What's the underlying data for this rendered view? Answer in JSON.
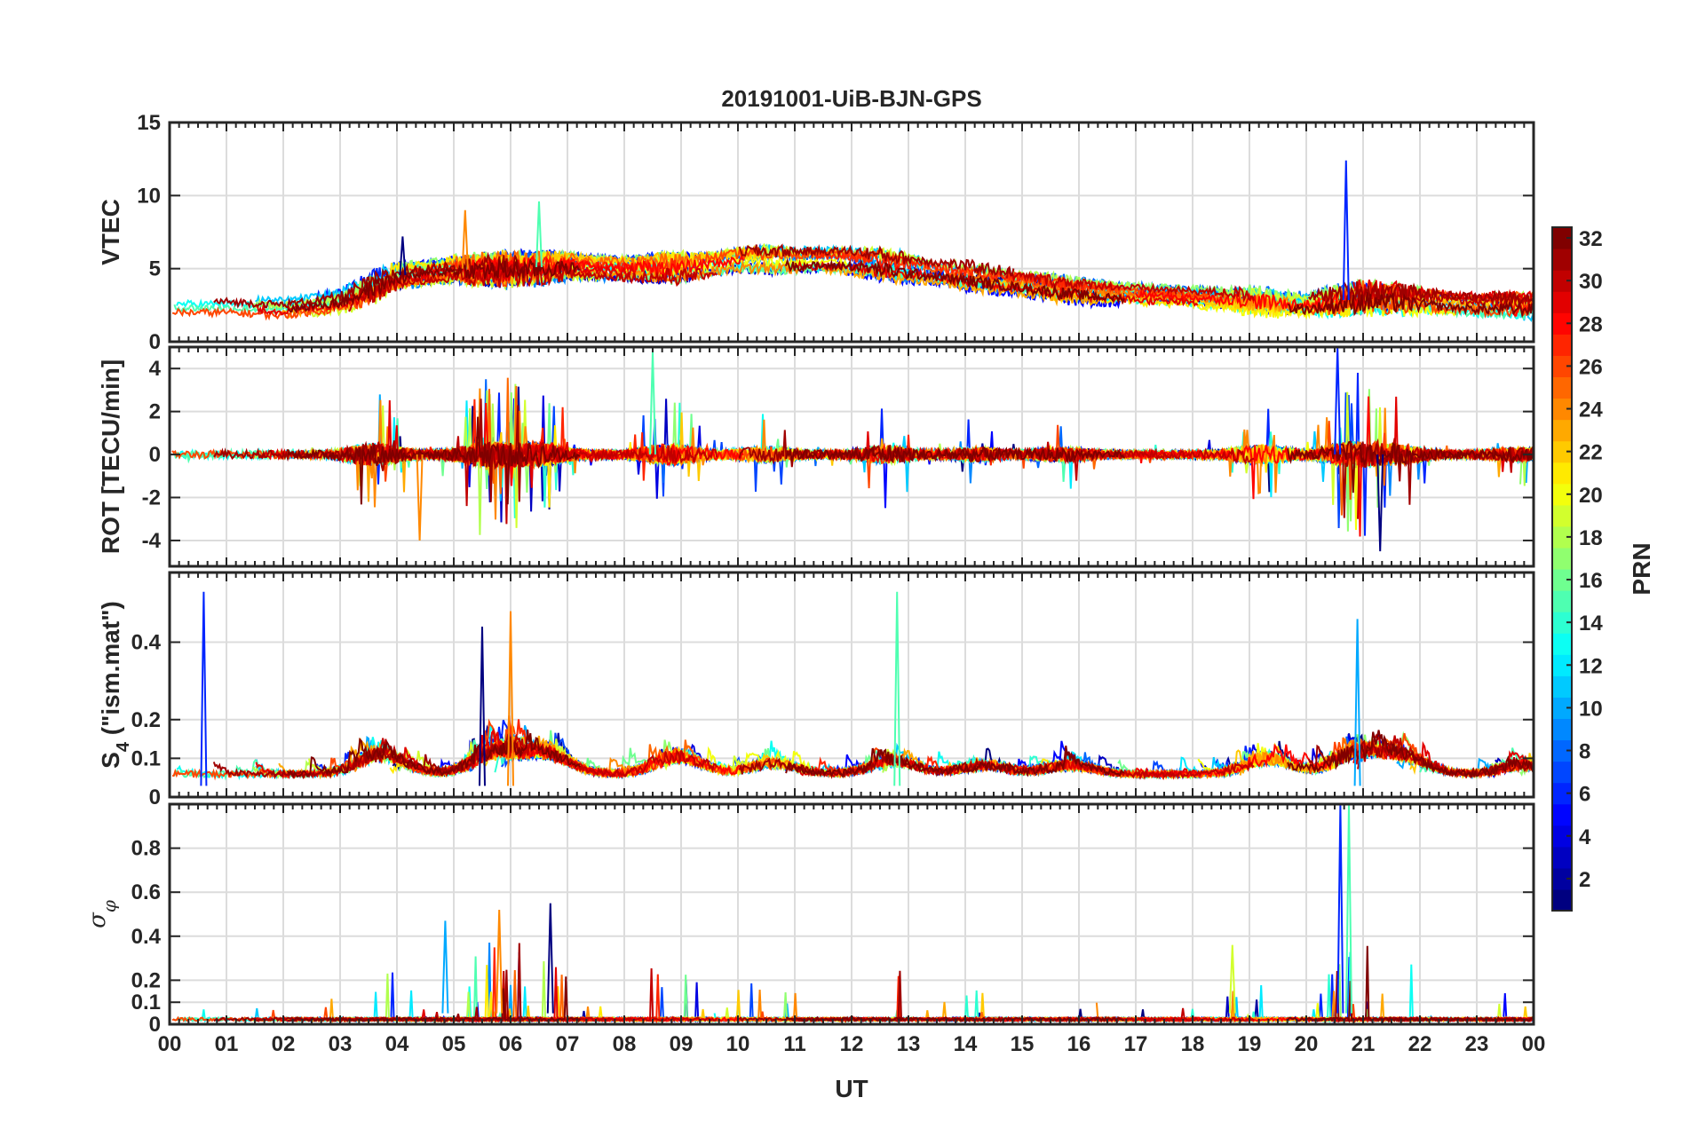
{
  "chart_data": {
    "type": "line",
    "title": "20191001-UiB-BJN-GPS",
    "xlabel": "UT",
    "xlim": [
      0,
      24
    ],
    "x_tick_labels": [
      "00",
      "01",
      "02",
      "03",
      "04",
      "05",
      "06",
      "07",
      "08",
      "09",
      "10",
      "11",
      "12",
      "13",
      "14",
      "15",
      "16",
      "17",
      "18",
      "19",
      "20",
      "21",
      "22",
      "23",
      "00"
    ],
    "grid": true,
    "colorbar": {
      "label": "PRN",
      "range": [
        1,
        32
      ],
      "tick_labels": [
        "2",
        "4",
        "6",
        "8",
        "10",
        "12",
        "14",
        "16",
        "18",
        "20",
        "22",
        "24",
        "26",
        "28",
        "30",
        "32"
      ],
      "colormap": "jet",
      "colors": [
        "#00008f",
        "#0000ff",
        "#0080ff",
        "#00ffff",
        "#80ff80",
        "#ffff00",
        "#ff8000",
        "#ff0000",
        "#800000"
      ]
    },
    "panels": [
      {
        "id": "vtec",
        "ylabel": "VTEC",
        "ylim": [
          0,
          15
        ],
        "y_tick_labels": [
          "0",
          "5",
          "10",
          "15"
        ],
        "description_points": {
          "x": [
            0,
            1,
            2,
            3,
            4,
            5,
            6,
            7,
            8,
            9,
            10,
            11,
            12,
            13,
            14,
            15,
            16,
            17,
            18,
            19,
            20,
            21,
            22,
            23,
            24
          ],
          "y": [
            2.5,
            2.5,
            2.3,
            2.8,
            4.5,
            5.0,
            5.0,
            5.2,
            5.0,
            5.0,
            5.5,
            5.5,
            5.5,
            5.0,
            4.5,
            4.0,
            3.5,
            3.2,
            3.0,
            2.8,
            2.5,
            3.0,
            2.8,
            2.5,
            2.5
          ]
        },
        "peaks": [
          {
            "x": 20.7,
            "y": 12.4
          },
          {
            "x": 6.5,
            "y": 9.6
          },
          {
            "x": 5.2,
            "y": 9.0
          },
          {
            "x": 4.1,
            "y": 7.2
          }
        ]
      },
      {
        "id": "rot",
        "ylabel": "ROT [TECU/min]",
        "ylim": [
          -5.2,
          5
        ],
        "y_tick_labels": [
          "-4",
          "-2",
          "0",
          "2",
          "4"
        ],
        "peaks": [
          {
            "x": 20.55,
            "y": 5.0
          },
          {
            "x": 8.5,
            "y": 4.8
          },
          {
            "x": 4.4,
            "y": -4.0
          },
          {
            "x": 21.3,
            "y": -4.5
          }
        ]
      },
      {
        "id": "s4",
        "ylabel": "S",
        "ylabel_sub": "4",
        "ylabel_suffix": " (\"ism.mat\")",
        "ylim": [
          0,
          0.58
        ],
        "y_tick_labels": [
          "0",
          "0.1",
          "0.2",
          "0.4"
        ],
        "peaks": [
          {
            "x": 0.6,
            "y": 0.53
          },
          {
            "x": 12.8,
            "y": 0.53
          },
          {
            "x": 6.0,
            "y": 0.48
          },
          {
            "x": 5.5,
            "y": 0.44
          },
          {
            "x": 20.9,
            "y": 0.46
          }
        ]
      },
      {
        "id": "sigma",
        "ylabel": "σ",
        "ylabel_sub": "φ",
        "ylim": [
          0,
          1.0
        ],
        "y_tick_labels": [
          "0",
          "0.1",
          "0.2",
          "0.4",
          "0.6",
          "0.8"
        ],
        "peaks": [
          {
            "x": 20.6,
            "y": 1.0
          },
          {
            "x": 20.75,
            "y": 1.0
          },
          {
            "x": 5.8,
            "y": 0.52
          },
          {
            "x": 6.7,
            "y": 0.55
          },
          {
            "x": 4.85,
            "y": 0.47
          },
          {
            "x": 18.7,
            "y": 0.36
          }
        ]
      }
    ]
  }
}
